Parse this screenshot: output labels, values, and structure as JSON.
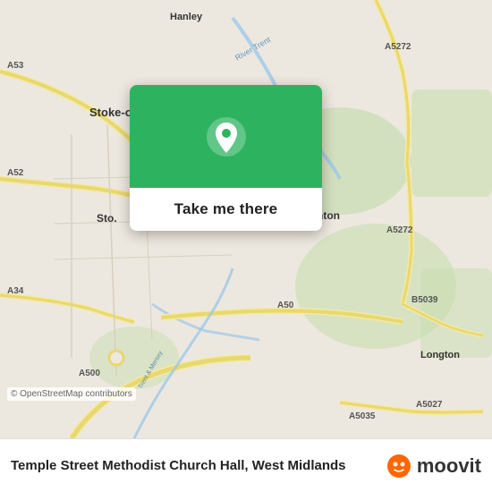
{
  "map": {
    "attribution": "© OpenStreetMap contributors",
    "center_location": "Stoke-on-Trent, West Midlands",
    "background_color": "#e8e0d8"
  },
  "popup": {
    "button_label": "Take me there",
    "green_color": "#2db360"
  },
  "footer": {
    "place_name": "Temple Street Methodist Church Hall, West Midlands",
    "logo_name": "moovit",
    "logo_text": "moovit"
  },
  "road_labels": [
    "A53",
    "A52",
    "A34",
    "A500",
    "A50",
    "A5272",
    "A5027",
    "B5039",
    "A5035",
    "Stoke-on-Trent",
    "Hanley",
    "Fenton",
    "Longton",
    "River Trent"
  ]
}
